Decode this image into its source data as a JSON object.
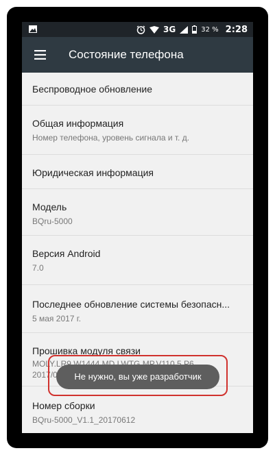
{
  "status_bar": {
    "network": "3G",
    "battery_percent": "32 %",
    "time": "2:28"
  },
  "app_bar": {
    "title": "Состояние телефона"
  },
  "items": [
    {
      "title": "Беспроводное обновление",
      "subtitle": ""
    },
    {
      "title": "Общая информация",
      "subtitle": "Номер телефона, уровень сигнала и т. д."
    },
    {
      "title": "Юридическая информация",
      "subtitle": ""
    },
    {
      "title": "Модель",
      "subtitle": "BQru-5000"
    },
    {
      "title": "Версия Android",
      "subtitle": "7.0"
    },
    {
      "title": "Последнее обновление системы безопасн...",
      "subtitle": "5 мая 2017 г."
    },
    {
      "title": "Прошивка модуля связи",
      "subtitle": "MOLY.LR9.W1444.MD.LWTG.MP.V110.5.P6",
      "subtitle2": "2017/05/05"
    },
    {
      "title": "Номер сборки",
      "subtitle": "BQru-5000_V1.1_20170612"
    }
  ],
  "toast": {
    "message": "Не нужно, вы уже разработчик"
  },
  "colors": {
    "status_bar": "#1f2429",
    "app_bar": "#2f3a42",
    "toast": "#5e5e5e",
    "highlight": "#d0312d"
  }
}
